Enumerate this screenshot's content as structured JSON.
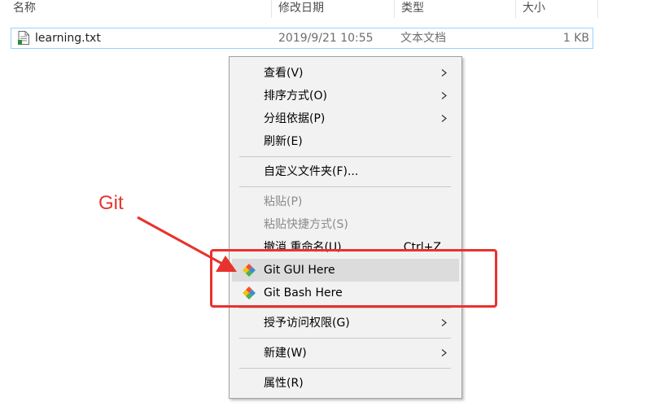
{
  "columns": {
    "name": "名称",
    "modified": "修改日期",
    "type": "类型",
    "size": "大小"
  },
  "file": {
    "name": "learning.txt",
    "modified": "2019/9/21 10:55",
    "type": "文本文档",
    "size": "1 KB",
    "icon": "text-file-icon"
  },
  "menu": {
    "view": "查看(V)",
    "sort": "排序方式(O)",
    "group": "分组依据(P)",
    "refresh": "刷新(E)",
    "customize": "自定义文件夹(F)...",
    "paste": "粘贴(P)",
    "paste_shortcut": "粘贴快捷方式(S)",
    "undo": "撤消 重命名(U)",
    "undo_shortcut": "Ctrl+Z",
    "git_gui": "Git GUI Here",
    "git_bash": "Git Bash Here",
    "give_access": "授予访问权限(G)",
    "new": "新建(W)",
    "properties": "属性(R)"
  },
  "annotation": {
    "label": "Git",
    "color": "#e8322e"
  }
}
